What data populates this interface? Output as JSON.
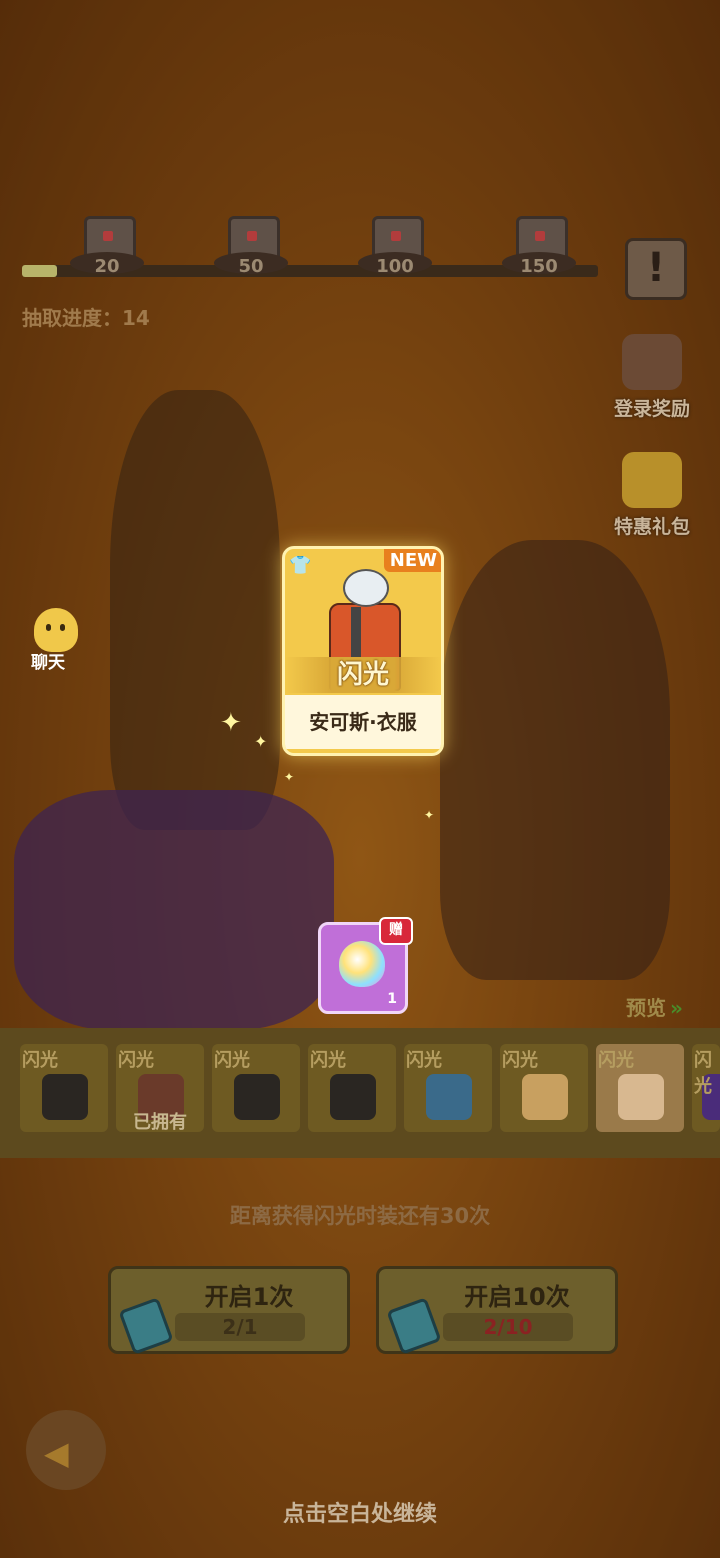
{
  "progress": {
    "milestones": [
      "20",
      "50",
      "100",
      "150"
    ],
    "fill_fraction": 0.06,
    "label": "抽取进度：14"
  },
  "side": {
    "info_symbol": "!",
    "login_reward": "登录奖励",
    "special_pack": "特惠礼包",
    "chat": "聊天"
  },
  "card": {
    "badge": "NEW",
    "rarity": "闪光",
    "name": "安可斯·衣服"
  },
  "bonus": {
    "tag": "赠",
    "quantity": "1"
  },
  "preview": {
    "label": "预览",
    "arrows": "»"
  },
  "strip": {
    "items": [
      {
        "rarity": "闪光",
        "owned": ""
      },
      {
        "rarity": "闪光",
        "owned": "已拥有"
      },
      {
        "rarity": "闪光",
        "owned": ""
      },
      {
        "rarity": "闪光",
        "owned": ""
      },
      {
        "rarity": "闪光",
        "owned": ""
      },
      {
        "rarity": "闪光",
        "owned": ""
      },
      {
        "rarity": "闪光",
        "owned": ""
      },
      {
        "rarity": "闪光",
        "owned": ""
      }
    ]
  },
  "hint": "距离获得闪光时装还有30次",
  "buttons": {
    "open1": {
      "label": "开启1次",
      "count": "2/1"
    },
    "open10": {
      "label": "开启10次",
      "count": "2/10"
    }
  },
  "continue_text": "点击空白处继续",
  "colors": {
    "card": "#f3c94b",
    "new_badge": "#e8801e",
    "bonus_bg": "#c06fd8",
    "insufficient": "#8a2222"
  },
  "icons": [
    "shirt-icon",
    "gem-icon",
    "ticket-icon",
    "back-arrow-icon",
    "chest-icon",
    "ghost-icon"
  ]
}
